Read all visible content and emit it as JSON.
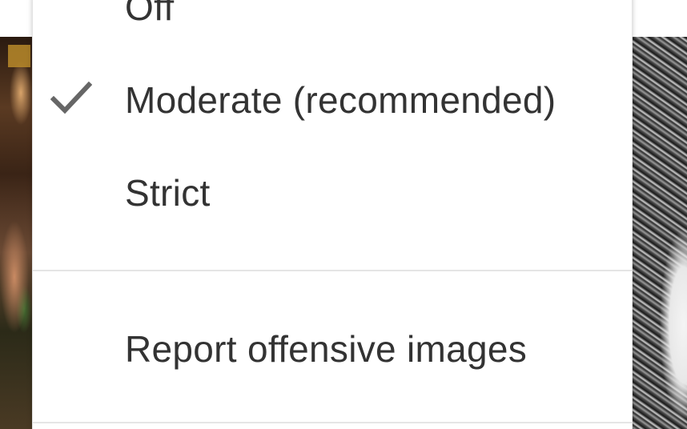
{
  "safesearch_menu": {
    "options": [
      {
        "label": "Off",
        "selected": false
      },
      {
        "label": "Moderate (recommended)",
        "selected": true
      },
      {
        "label": "Strict",
        "selected": false
      }
    ],
    "selected_icon": "checkmark-icon",
    "report_label": "Report offensive images"
  },
  "colors": {
    "menu_background": "#ffffff",
    "text": "#333333",
    "check": "#666666",
    "divider": "#e5e5e5"
  }
}
